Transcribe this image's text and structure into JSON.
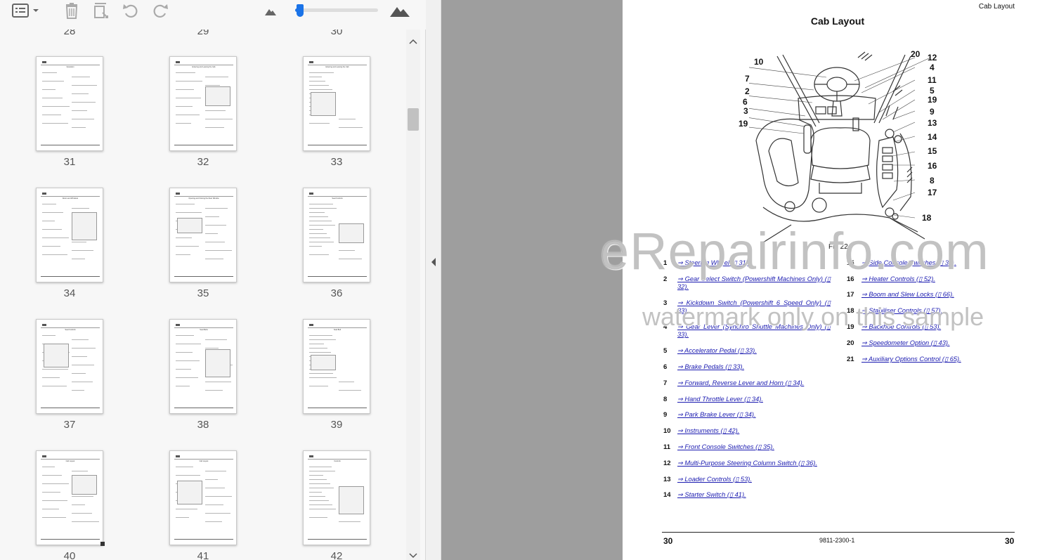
{
  "toolbar": {
    "items": [
      "thumbnail-view-icon",
      "delete-icon",
      "extract-pages-icon",
      "undo-icon",
      "redo-icon",
      "zoom-out-mountain-icon",
      "zoom-slider",
      "zoom-in-mountain-icon"
    ],
    "zoom_level": 0.02
  },
  "thumbnails": {
    "top_partial_labels": [
      "28",
      "29",
      "30"
    ],
    "pages": [
      {
        "num": "31",
        "title": "Operation"
      },
      {
        "num": "32",
        "title": "Entering and Leaving the Cab"
      },
      {
        "num": "33",
        "title": "Entering and Leaving the Cab"
      },
      {
        "num": "34",
        "title": "Doors and Windows"
      },
      {
        "num": "35",
        "title": "Opening and Closing the Rear Window"
      },
      {
        "num": "36",
        "title": "Seat Controls"
      },
      {
        "num": "37",
        "title": "Seat Controls"
      },
      {
        "num": "38",
        "title": "Seat Belts"
      },
      {
        "num": "39",
        "title": "Seat Belt"
      },
      {
        "num": "40",
        "title": "Cab Layout"
      },
      {
        "num": "41",
        "title": "Cab Layout"
      },
      {
        "num": "42",
        "title": "Controls"
      }
    ]
  },
  "document": {
    "running_head": "Cab Layout",
    "title": "Cab Layout",
    "figure_caption": "Fig 22.",
    "callouts": [
      "10",
      "7",
      "2",
      "6",
      "3",
      "19",
      "20",
      "12",
      "4",
      "11",
      "5",
      "19",
      "9",
      "13",
      "14",
      "15",
      "16",
      "8",
      "17",
      "18"
    ],
    "left_items": [
      {
        "num": "1",
        "text": "⇒ Steering Wheel (▯ 31)."
      },
      {
        "num": "2",
        "text": "⇒ Gear Select Switch (Powershift Machines Only) (▯ 32)."
      },
      {
        "num": "3",
        "text": "⇒ Kickdown Switch (Powershift 6 Speed Only) (▯ 33)."
      },
      {
        "num": "4",
        "text": "⇒ Gear Lever (Synchro Shuttle Machines Only) (▯ 33)."
      },
      {
        "num": "5",
        "text": "⇒ Accelerator Pedal (▯ 33)."
      },
      {
        "num": "6",
        "text": "⇒ Brake Pedals (▯ 33)."
      },
      {
        "num": "7",
        "text": "⇒ Forward, Reverse Lever and Horn (▯ 34)."
      },
      {
        "num": "8",
        "text": "⇒ Hand Throttle Lever (▯ 34)."
      },
      {
        "num": "9",
        "text": "⇒ Park Brake Lever (▯ 34)."
      },
      {
        "num": "10",
        "text": "⇒ Instruments (▯ 42)."
      },
      {
        "num": "11",
        "text": "⇒ Front Console Switches (▯ 35)."
      },
      {
        "num": "12",
        "text": "⇒ Multi-Purpose Steering Column Switch (▯ 36)."
      },
      {
        "num": "13",
        "text": "⇒ Loader Controls (▯ 53)."
      },
      {
        "num": "14",
        "text": "⇒ Starter Switch (▯ 41)."
      }
    ],
    "right_items": [
      {
        "num": "15",
        "text": "⇒ Side Console Switches (▯ 35)."
      },
      {
        "num": "16",
        "text": "⇒ Heater Controls (▯ 52)."
      },
      {
        "num": "17",
        "text": "⇒ Boom and Slew Locks (▯ 66)."
      },
      {
        "num": "18",
        "text": "⇒ Stabiliser Controls (▯ 57)."
      },
      {
        "num": "19",
        "text": "⇒ Backhoe Controls (▯ 53)."
      },
      {
        "num": "20",
        "text": "⇒ Speedometer Option (▯ 43)."
      },
      {
        "num": "21",
        "text": "⇒ Auxiliary Options Control (▯ 65)."
      }
    ],
    "footer_left": "30",
    "footer_center": "9811-2300-1",
    "footer_right": "30"
  },
  "watermark": {
    "main": "eRepairinfo.com",
    "sub": "watermark only on this sample"
  },
  "colors": {
    "link": "#1a1ab0",
    "accent": "#1a73e8",
    "viewer_gray": "#9e9e9e"
  }
}
